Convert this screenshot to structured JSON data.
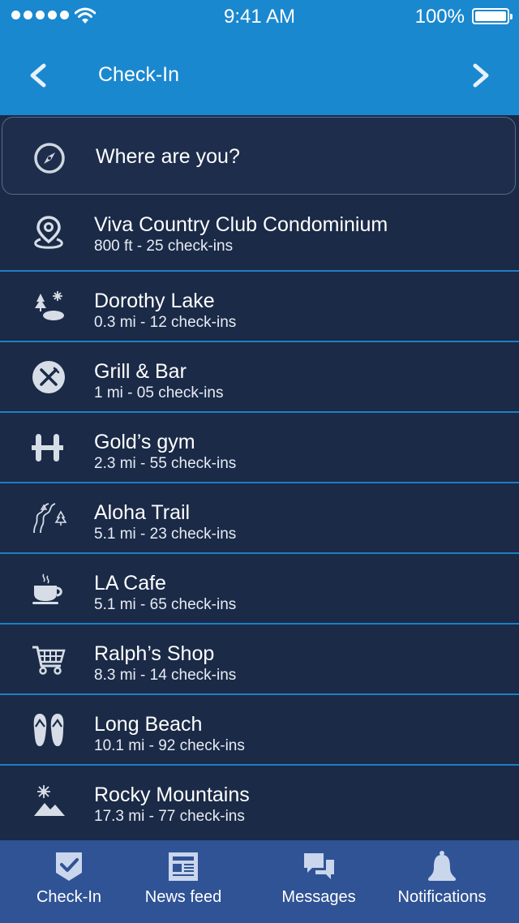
{
  "status_bar": {
    "time": "9:41 AM",
    "battery": "100%"
  },
  "nav": {
    "title": "Check-In"
  },
  "search": {
    "placeholder": "Where are you?"
  },
  "places": [
    {
      "name": "Viva Country Club Condominium",
      "meta": "800 ft - 25 check-ins",
      "icon": "location-pin-icon"
    },
    {
      "name": "Dorothy Lake",
      "meta": "0.3 mi - 12 check-ins",
      "icon": "lake-icon"
    },
    {
      "name": "Grill & Bar",
      "meta": "1 mi - 05 check-ins",
      "icon": "fork-knife-icon"
    },
    {
      "name": "Gold’s gym",
      "meta": "2.3 mi - 55 check-ins",
      "icon": "dumbbell-icon"
    },
    {
      "name": "Aloha Trail",
      "meta": "5.1 mi - 23 check-ins",
      "icon": "trail-icon"
    },
    {
      "name": "LA Cafe",
      "meta": "5.1 mi - 65 check-ins",
      "icon": "coffee-cup-icon"
    },
    {
      "name": "Ralph’s Shop",
      "meta": "8.3 mi - 14 check-ins",
      "icon": "shopping-cart-icon"
    },
    {
      "name": "Long Beach",
      "meta": "10.1 mi - 92 check-ins",
      "icon": "flip-flops-icon"
    },
    {
      "name": "Rocky Mountains",
      "meta": "17.3 mi - 77 check-ins",
      "icon": "mountains-icon"
    }
  ],
  "tabs": [
    {
      "label": "Check-In",
      "icon": "check-badge-icon"
    },
    {
      "label": "News feed",
      "icon": "newspaper-icon"
    },
    {
      "label": "Messages",
      "icon": "chat-bubbles-icon"
    },
    {
      "label": "Notifications",
      "icon": "bell-icon"
    }
  ],
  "colors": {
    "header": "#1a88cf",
    "background": "#1a2a47",
    "divider": "#1f7fc4",
    "tabbar": "#2f5395",
    "icon": "#d7dde6"
  }
}
